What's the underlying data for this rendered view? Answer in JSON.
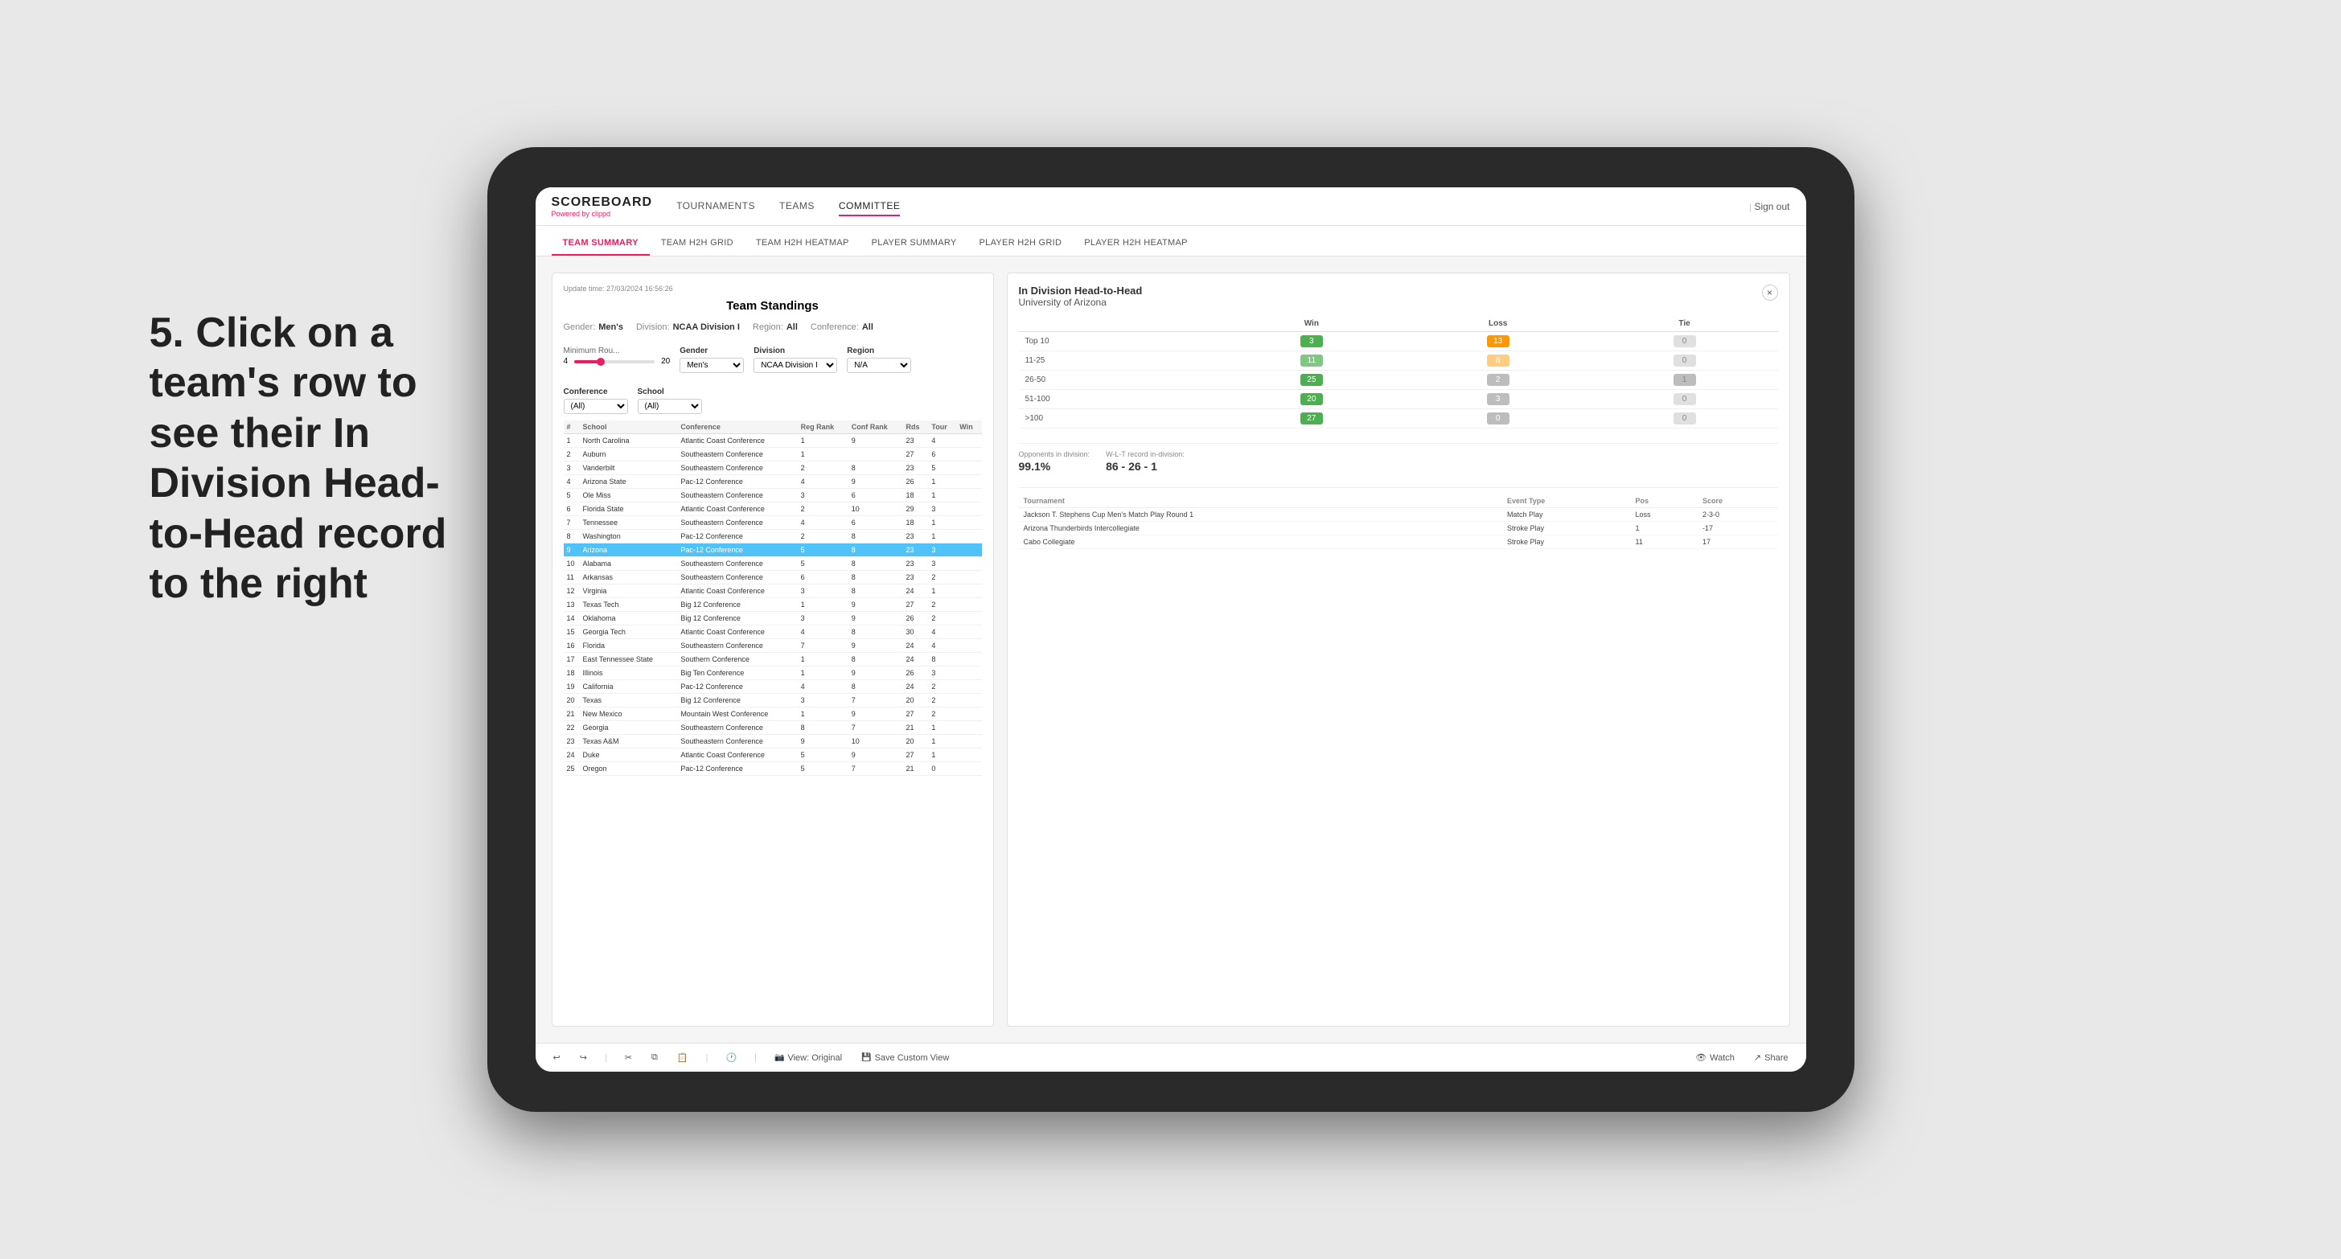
{
  "meta": {
    "bg_color": "#e8e8e8"
  },
  "annotation": {
    "text": "5. Click on a team's row to see their In Division Head-to-Head record to the right"
  },
  "nav": {
    "logo": "SCOREBOARD",
    "logo_sub": "Powered by ",
    "logo_brand": "clippd",
    "items": [
      "TOURNAMENTS",
      "TEAMS",
      "COMMITTEE"
    ],
    "active": "COMMITTEE",
    "sign_out": "Sign out"
  },
  "sub_nav": {
    "items": [
      "TEAM SUMMARY",
      "TEAM H2H GRID",
      "TEAM H2H HEATMAP",
      "PLAYER SUMMARY",
      "PLAYER H2H GRID",
      "PLAYER H2H HEATMAP"
    ],
    "active": "TEAM SUMMARY"
  },
  "panel": {
    "title": "Team Standings",
    "update_time": "Update time: 27/03/2024 16:56:26",
    "filters": {
      "gender_label": "Gender:",
      "gender_value": "Men's",
      "division_label": "Division:",
      "division_value": "NCAA Division I",
      "region_label": "Region:",
      "region_value": "All",
      "conference_label": "Conference:",
      "conference_value": "All"
    },
    "min_rounds_label": "Minimum Rou...",
    "min_rounds_value": "4",
    "min_rounds_max": "20",
    "gender_select": "Men's",
    "division_select": "NCAA Division I",
    "region_select": "N/A",
    "conference_select": "(All)",
    "school_select": "(All)",
    "columns": [
      "#",
      "School",
      "Conference",
      "Reg Rank",
      "Conf Rank",
      "Rds",
      "Tour",
      "Win"
    ],
    "rows": [
      {
        "rank": 1,
        "school": "North Carolina",
        "conference": "Atlantic Coast Conference",
        "reg_rank": 1,
        "conf_rank": 9,
        "rds": 23,
        "tour": 4,
        "win": ""
      },
      {
        "rank": 2,
        "school": "Auburn",
        "conference": "Southeastern Conference",
        "reg_rank": 1,
        "conf_rank": "",
        "rds": 27,
        "tour": 6,
        "win": ""
      },
      {
        "rank": 3,
        "school": "Vanderbilt",
        "conference": "Southeastern Conference",
        "reg_rank": 2,
        "conf_rank": 8,
        "rds": 23,
        "tour": 5,
        "win": ""
      },
      {
        "rank": 4,
        "school": "Arizona State",
        "conference": "Pac-12 Conference",
        "reg_rank": 4,
        "conf_rank": 9,
        "rds": 26,
        "tour": 1,
        "win": ""
      },
      {
        "rank": 5,
        "school": "Ole Miss",
        "conference": "Southeastern Conference",
        "reg_rank": 3,
        "conf_rank": 6,
        "rds": 18,
        "tour": 1,
        "win": ""
      },
      {
        "rank": 6,
        "school": "Florida State",
        "conference": "Atlantic Coast Conference",
        "reg_rank": 2,
        "conf_rank": 10,
        "rds": 29,
        "tour": 3,
        "win": ""
      },
      {
        "rank": 7,
        "school": "Tennessee",
        "conference": "Southeastern Conference",
        "reg_rank": 4,
        "conf_rank": 6,
        "rds": 18,
        "tour": 1,
        "win": ""
      },
      {
        "rank": 8,
        "school": "Washington",
        "conference": "Pac-12 Conference",
        "reg_rank": 2,
        "conf_rank": 8,
        "rds": 23,
        "tour": 1,
        "win": ""
      },
      {
        "rank": 9,
        "school": "Arizona",
        "conference": "Pac-12 Conference",
        "reg_rank": 5,
        "conf_rank": 8,
        "rds": 23,
        "tour": 3,
        "win": "",
        "selected": true
      },
      {
        "rank": 10,
        "school": "Alabama",
        "conference": "Southeastern Conference",
        "reg_rank": 5,
        "conf_rank": 8,
        "rds": 23,
        "tour": 3,
        "win": ""
      },
      {
        "rank": 11,
        "school": "Arkansas",
        "conference": "Southeastern Conference",
        "reg_rank": 6,
        "conf_rank": 8,
        "rds": 23,
        "tour": 2,
        "win": ""
      },
      {
        "rank": 12,
        "school": "Virginia",
        "conference": "Atlantic Coast Conference",
        "reg_rank": 3,
        "conf_rank": 8,
        "rds": 24,
        "tour": 1,
        "win": ""
      },
      {
        "rank": 13,
        "school": "Texas Tech",
        "conference": "Big 12 Conference",
        "reg_rank": 1,
        "conf_rank": 9,
        "rds": 27,
        "tour": 2,
        "win": ""
      },
      {
        "rank": 14,
        "school": "Oklahoma",
        "conference": "Big 12 Conference",
        "reg_rank": 3,
        "conf_rank": 9,
        "rds": 26,
        "tour": 2,
        "win": ""
      },
      {
        "rank": 15,
        "school": "Georgia Tech",
        "conference": "Atlantic Coast Conference",
        "reg_rank": 4,
        "conf_rank": 8,
        "rds": 30,
        "tour": 4,
        "win": ""
      },
      {
        "rank": 16,
        "school": "Florida",
        "conference": "Southeastern Conference",
        "reg_rank": 7,
        "conf_rank": 9,
        "rds": 24,
        "tour": 4,
        "win": ""
      },
      {
        "rank": 17,
        "school": "East Tennessee State",
        "conference": "Southern Conference",
        "reg_rank": 1,
        "conf_rank": 8,
        "rds": 24,
        "tour": 8,
        "win": ""
      },
      {
        "rank": 18,
        "school": "Illinois",
        "conference": "Big Ten Conference",
        "reg_rank": 1,
        "conf_rank": 9,
        "rds": 26,
        "tour": 3,
        "win": ""
      },
      {
        "rank": 19,
        "school": "California",
        "conference": "Pac-12 Conference",
        "reg_rank": 4,
        "conf_rank": 8,
        "rds": 24,
        "tour": 2,
        "win": ""
      },
      {
        "rank": 20,
        "school": "Texas",
        "conference": "Big 12 Conference",
        "reg_rank": 3,
        "conf_rank": 7,
        "rds": 20,
        "tour": 2,
        "win": ""
      },
      {
        "rank": 21,
        "school": "New Mexico",
        "conference": "Mountain West Conference",
        "reg_rank": 1,
        "conf_rank": 9,
        "rds": 27,
        "tour": 2,
        "win": ""
      },
      {
        "rank": 22,
        "school": "Georgia",
        "conference": "Southeastern Conference",
        "reg_rank": 8,
        "conf_rank": 7,
        "rds": 21,
        "tour": 1,
        "win": ""
      },
      {
        "rank": 23,
        "school": "Texas A&M",
        "conference": "Southeastern Conference",
        "reg_rank": 9,
        "conf_rank": 10,
        "rds": 20,
        "tour": 1,
        "win": ""
      },
      {
        "rank": 24,
        "school": "Duke",
        "conference": "Atlantic Coast Conference",
        "reg_rank": 5,
        "conf_rank": 9,
        "rds": 27,
        "tour": 1,
        "win": ""
      },
      {
        "rank": 25,
        "school": "Oregon",
        "conference": "Pac-12 Conference",
        "reg_rank": 5,
        "conf_rank": 7,
        "rds": 21,
        "tour": 0,
        "win": ""
      }
    ]
  },
  "h2h": {
    "title": "In Division Head-to-Head",
    "team": "University of Arizona",
    "close_btn": "×",
    "columns": [
      "",
      "Win",
      "Loss",
      "Tie"
    ],
    "rows": [
      {
        "label": "Top 10",
        "win": 3,
        "loss": 13,
        "tie": 0,
        "win_color": "green",
        "loss_color": "orange"
      },
      {
        "label": "11-25",
        "win": 11,
        "loss": 8,
        "tie": 0,
        "win_color": "light-green",
        "loss_color": "light-orange"
      },
      {
        "label": "26-50",
        "win": 25,
        "loss": 2,
        "tie": 1,
        "win_color": "green",
        "loss_color": "gray"
      },
      {
        "label": "51-100",
        "win": 20,
        "loss": 3,
        "tie": 0,
        "win_color": "green",
        "loss_color": "gray"
      },
      {
        "label": ">100",
        "win": 27,
        "loss": 0,
        "tie": 0,
        "win_color": "green",
        "loss_color": "gray"
      }
    ],
    "opponents_label": "Opponents in division:",
    "opponents_value": "99.1%",
    "record_label": "W-L-T record in-division:",
    "record_value": "86 - 26 - 1",
    "tournament_columns": [
      "Tournament",
      "Event Type",
      "Pos",
      "Score"
    ],
    "tournaments": [
      {
        "name": "Jackson T. Stephens Cup Men's Match Play Round 1",
        "event_type": "Match Play",
        "pos": "Loss",
        "score": "2-3-0"
      },
      {
        "name": "Arizona Thunderbirds Intercollegiate",
        "event_type": "Stroke Play",
        "pos": "1",
        "score": "-17"
      },
      {
        "name": "Cabo Collegiate",
        "event_type": "Stroke Play",
        "pos": "11",
        "score": "17"
      }
    ]
  },
  "toolbar": {
    "undo": "↩",
    "redo": "↪",
    "view_original": "View: Original",
    "save_custom": "Save Custom View",
    "watch": "Watch",
    "share": "Share"
  }
}
